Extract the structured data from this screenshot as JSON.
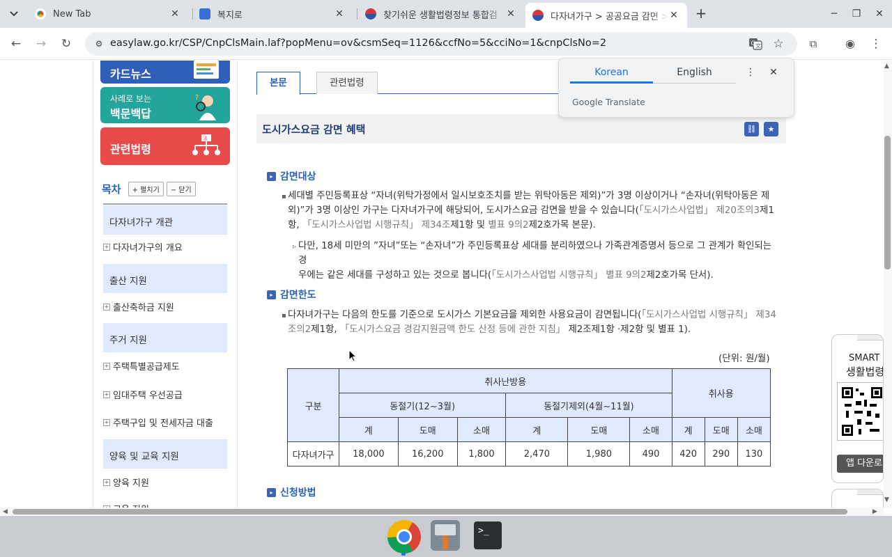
{
  "browser": {
    "tabs": [
      {
        "title": "New Tab"
      },
      {
        "title": "복지로"
      },
      {
        "title": "찾기쉬운 생활법령정보 통합검"
      },
      {
        "title": "다자녀가구 > 공공요금 감면 >"
      }
    ],
    "url": "easylaw.go.kr/CSP/CnpClsMain.laf?popMenu=ov&csmSeq=1126&ccfNo=5&cciNo=1&cnpClsNo=2"
  },
  "translate_popup": {
    "lang_active": "Korean",
    "lang_other": "English",
    "brand": "Google Translate"
  },
  "sidebar": {
    "banners": [
      {
        "small": "",
        "big": "카드뉴스"
      },
      {
        "small": "사례로 보는",
        "big": "백문백답"
      },
      {
        "small": "",
        "big": "관련법령"
      }
    ],
    "toc_title": "목차",
    "expand_label": "+ 펼치기",
    "collapse_label": "− 닫기",
    "categories": [
      "다자녀가구 개관",
      "출산 지원",
      "주거 지원",
      "양육 및 교육 지원"
    ],
    "items": [
      "다자녀가구의 개요",
      "출산축하금 지원",
      "주택특별공급제도",
      "임대주택 우선공급",
      "주택구입 및 전세자금 대출",
      "양육 지원",
      "교육 지원"
    ]
  },
  "content": {
    "tab_main": "본문",
    "tab_law": "관련법령",
    "section_title": "도시가스요금 감면 혜택",
    "h_target": "감면대상",
    "p1_a": "세대별 주민등록표상 “자녀(위탁가정에서 일시보호조치를 받는 위탁아동은 제외)”가 3명 이상이거나 “손자녀(위탁아동은 제",
    "p1_b1": "외)”가 3명 이상인 가구는 다자녀가구에 해당되어, 도시가스요금 감면을 받을 수 있습니다(",
    "p1_b2": "「도시가스사업법」 제20조의3",
    "p1_b3": "제1",
    "p1_c1": "항, ",
    "p1_c2": "「도시가스사업법 시행규칙」 제34조",
    "p1_c3": "제1항 및 ",
    "p1_c4": "별표 9의2",
    "p1_c5": "제2호가목 본문).",
    "p2_a": "다만, 18세 미만의 ”자녀”또는 “손자녀”가 주민등록표상 세대를 분리하였으나 가족관계증명서 등으로 그 관계가 확인되는 경",
    "p2_b1": "우에는 같은 세대를 구성하고 있는 것으로 봅니다(",
    "p2_b2": "「도시가스사업법 시행규칙」 별표 9의2",
    "p2_b3": "제2호가목 단서).",
    "h_limit": "감면한도",
    "p3_a1": "다자녀가구는 다음의 한도를 기준으로 도시가스 기본요금을 제외한 사용요금이 감면됩니다(",
    "p3_a2": "「도시가스사업법 시행규칙」 제34",
    "p3_b1": "조의2",
    "p3_b2": "제1항, ",
    "p3_b3": "「도시가스요금 경감지원금액 한도 산정 등에 관한 지침」",
    "p3_b4": " 제2조제1항 ·제2항 및 별표 1).",
    "unit": "(단위: 원/월)",
    "h_apply": "신청방법"
  },
  "table": {
    "col_group": "구분",
    "heating": "취사난방용",
    "winter": "동절기(12~3월)",
    "nonwinter": "동절기제외(4월~11월)",
    "cooking": "취사용",
    "sub": [
      "계",
      "도매",
      "소매",
      "계",
      "도매",
      "소매",
      "계",
      "도매",
      "소매"
    ],
    "row_label": "다자녀가구",
    "row": [
      "18,000",
      "16,200",
      "1,800",
      "2,470",
      "1,980",
      "490",
      "420",
      "290",
      "130"
    ]
  },
  "qr_panel": {
    "line1": "SMART",
    "line2": "생활법령",
    "button": "앱 다운로드"
  }
}
